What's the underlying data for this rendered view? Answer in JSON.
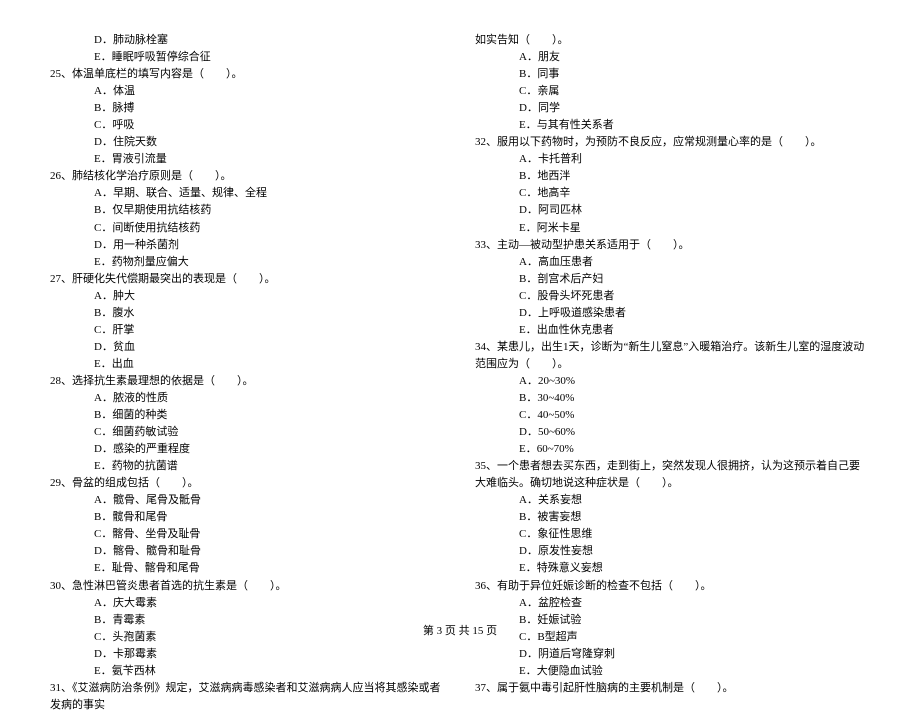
{
  "left": {
    "pre_opts": [
      "D．肺动脉栓塞",
      "E．睡眠呼吸暂停综合征"
    ],
    "q25": {
      "stem": "25、体温单底栏的填写内容是（　　）。",
      "opts": [
        "A．体温",
        "B．脉搏",
        "C．呼吸",
        "D．住院天数",
        "E．胃液引流量"
      ]
    },
    "q26": {
      "stem": "26、肺结核化学治疗原则是（　　）。",
      "opts": [
        "A．早期、联合、适量、规律、全程",
        "B．仅早期使用抗结核药",
        "C．间断使用抗结核药",
        "D．用一种杀菌剂",
        "E．药物剂量应偏大"
      ]
    },
    "q27": {
      "stem": "27、肝硬化失代偿期最突出的表现是（　　）。",
      "opts": [
        "A．肿大",
        "B．腹水",
        "C．肝掌",
        "D．贫血",
        "E．出血"
      ]
    },
    "q28": {
      "stem": "28、选择抗生素最理想的依据是（　　）。",
      "opts": [
        "A．脓液的性质",
        "B．细菌的种类",
        "C．细菌药敏试验",
        "D．感染的严重程度",
        "E．药物的抗菌谱"
      ]
    },
    "q29": {
      "stem": "29、骨盆的组成包括（　　）。",
      "opts": [
        "A．髋骨、尾骨及骶骨",
        "B．髋骨和尾骨",
        "C．髂骨、坐骨及耻骨",
        "D．髂骨、髋骨和耻骨",
        "E．耻骨、髂骨和尾骨"
      ]
    },
    "q30": {
      "stem": "30、急性淋巴管炎患者首选的抗生素是（　　）。",
      "opts": [
        "A．庆大霉素",
        "B．青霉素",
        "C．头孢菌素",
        "D．卡那霉素",
        "E．氨苄西林"
      ]
    },
    "q31": {
      "stem": "31、《艾滋病防治条例》规定，艾滋病病毒感染者和艾滋病病人应当将其感染或者发病的事实"
    }
  },
  "right": {
    "q31_cont": "如实告知（　　）。",
    "q31_opts": [
      "A．朋友",
      "B．同事",
      "C．亲属",
      "D．同学",
      "E．与其有性关系者"
    ],
    "q32": {
      "stem": "32、服用以下药物时，为预防不良反应，应常规测量心率的是（　　）。",
      "opts": [
        "A．卡托普利",
        "B．地西泮",
        "C．地高辛",
        "D．阿司匹林",
        "E．阿米卡星"
      ]
    },
    "q33": {
      "stem": "33、主动—被动型护患关系适用于（　　）。",
      "opts": [
        "A．高血压患者",
        "B．剖宫术后产妇",
        "C．股骨头坏死患者",
        "D．上呼吸道感染患者",
        "E．出血性休克患者"
      ]
    },
    "q34": {
      "stem": "34、某患儿，出生1天，诊断为“新生儿窒息”入暖箱治疗。该新生儿室的湿度波动范围应为（　　）。",
      "opts": [
        "A．20~30%",
        "B．30~40%",
        "C．40~50%",
        "D．50~60%",
        "E．60~70%"
      ]
    },
    "q35": {
      "stem": "35、一个患者想去买东西，走到街上，突然发现人很拥挤，认为这预示着自己要大难临头。确切地说这种症状是（　　）。",
      "opts": [
        "A．关系妄想",
        "B．被害妄想",
        "C．象征性思维",
        "D．原发性妄想",
        "E．特殊意义妄想"
      ]
    },
    "q36": {
      "stem": "36、有助于异位妊娠诊断的检查不包括（　　）。",
      "opts": [
        "A．盆腔检查",
        "B．妊娠试验",
        "C．B型超声",
        "D．阴道后穹隆穿刺",
        "E．大便隐血试验"
      ]
    },
    "q37": {
      "stem": "37、属于氨中毒引起肝性脑病的主要机制是（　　）。"
    }
  },
  "footer": "第 3 页 共 15 页"
}
